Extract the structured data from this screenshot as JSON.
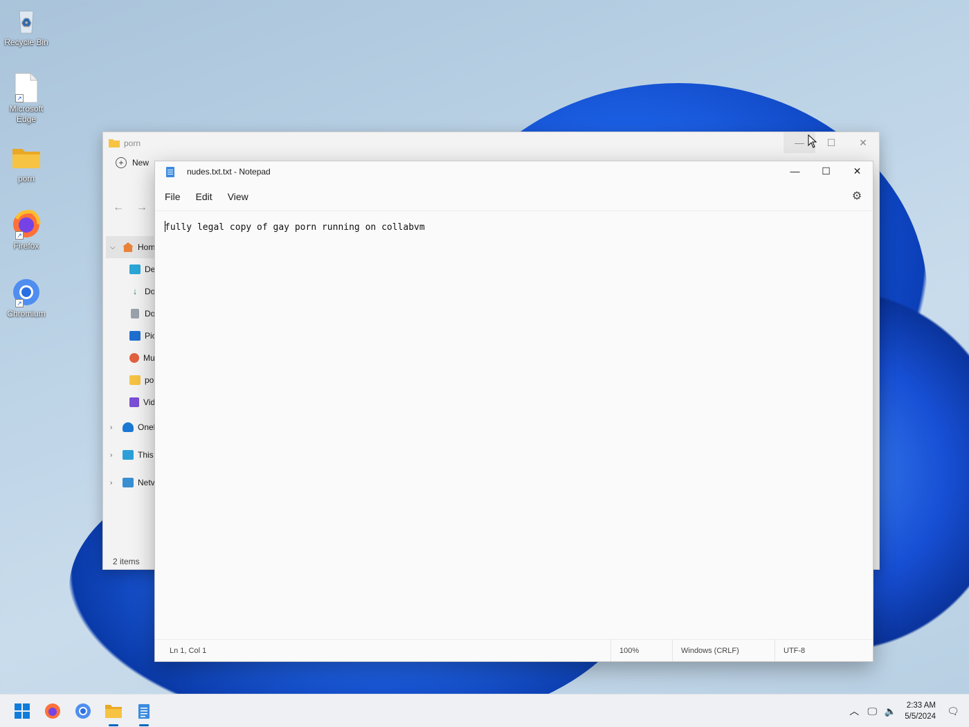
{
  "desktop": {
    "icons": [
      {
        "label": "Recycle Bin",
        "icon": "recycle-bin-icon"
      },
      {
        "label": "Microsoft Edge",
        "icon": "edge-file-icon"
      },
      {
        "label": "porn",
        "icon": "folder-icon"
      },
      {
        "label": "Firefox",
        "icon": "firefox-icon"
      },
      {
        "label": "Chromium",
        "icon": "chromium-icon"
      }
    ]
  },
  "explorer": {
    "title": "porn",
    "new_label": "New",
    "nav": {
      "home": "Hom",
      "children": [
        "De",
        "Do",
        "Do",
        "Pic",
        "Mu",
        "po",
        "Vid"
      ],
      "onedrive": "Onel",
      "this_pc": "This",
      "network": "Netv"
    },
    "status": "2 items"
  },
  "notepad": {
    "title": "nudes.txt.txt - Notepad",
    "menu": [
      "File",
      "Edit",
      "View"
    ],
    "content": "fully legal copy of gay porn running on collabvm",
    "status": {
      "position": "Ln 1, Col 1",
      "zoom": "100%",
      "line_ending": "Windows (CRLF)",
      "encoding": "UTF-8"
    }
  },
  "taskbar": {
    "time": "2:33 AM",
    "date": "5/5/2024"
  },
  "colors": {
    "accent": "#0067c0",
    "wallpaper_blue": "#1c5fe3",
    "folder_yellow": "#f6c343"
  }
}
